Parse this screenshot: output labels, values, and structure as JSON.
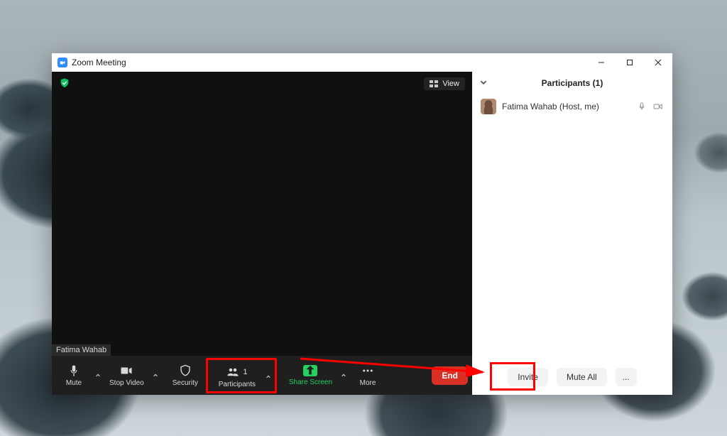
{
  "window": {
    "title": "Zoom Meeting"
  },
  "video": {
    "view_label": "View",
    "self_name": "Fatima Wahab"
  },
  "toolbar": {
    "mute": "Mute",
    "stop_video": "Stop Video",
    "security": "Security",
    "participants": "Participants",
    "participants_count": "1",
    "share_screen": "Share Screen",
    "more": "More",
    "end": "End"
  },
  "panel": {
    "title": "Participants (1)",
    "participants": [
      {
        "name": "Fatima Wahab (Host, me)"
      }
    ],
    "invite": "Invite",
    "mute_all": "Mute All",
    "more": "..."
  }
}
